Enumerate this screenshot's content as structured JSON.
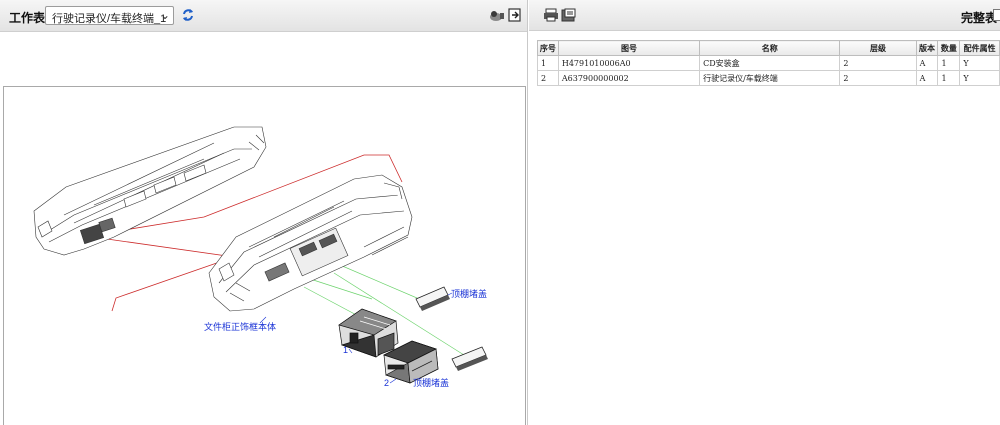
{
  "left_toolbar": {
    "label": "工作表",
    "selected_sheet": "行驶记录仪/车载终端_1",
    "icons": [
      "refresh-icon",
      "zoom-icon",
      "exit-icon"
    ]
  },
  "drawing": {
    "callouts": {
      "item1": "1",
      "item2": "2",
      "roof_cap_upper": "顶棚堵盖",
      "roof_cap_lower": "顶棚堵盖",
      "cabinet_frame": "文件柜正饰框本体"
    },
    "colors": {
      "callout": "#1a33d6",
      "leader": "#cc2b2b",
      "guide": "#6dd36d"
    }
  },
  "right_toolbar": {
    "icons": [
      "print-icon",
      "export-icon"
    ],
    "full_table_label": "完整表"
  },
  "parts_table": {
    "headers": [
      "序号",
      "图号",
      "名称",
      "层级",
      "版本",
      "数量",
      "配件属性"
    ],
    "rows": [
      [
        "1",
        "H4791010006A0",
        "CD安装盒",
        "2",
        "A",
        "1",
        "Y"
      ],
      [
        "2",
        "A637900000002",
        "行驶记录仪/车载终端",
        "2",
        "A",
        "1",
        "Y"
      ]
    ]
  }
}
